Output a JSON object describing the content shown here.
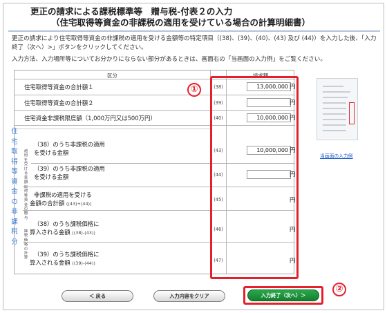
{
  "title": {
    "line1": "更正の請求による課税標準等　贈与税-付表２の入力",
    "line2": "（住宅取得等資金の非課税の適用を受けている場合の計算明細書）"
  },
  "intro": {
    "text": "更正の請求により住宅取得等資金の非課税の適用を受ける金額等の特定項目（(38)、(39)、(40)、(43) 及び (44)）を入力した後、「入力終了（次へ）>」ボタンをクリックしてください。",
    "help": "入力方法、入力場所等についてお分かりにならない部分があるときは、画面右の「当画面の入力例」をご覧ください。"
  },
  "table": {
    "header_category": "区分",
    "header_amount": "請求額",
    "side_label": "住宅取得等資金の非課税分",
    "side_small_top": "適用を受ける金額",
    "side_small_mid": "取得等資金の贈与",
    "side_small_bottom": "課税価格の計算",
    "rows": [
      {
        "label": "住宅取得等資金の合計額１",
        "num": "(38)",
        "value": "13,000,000",
        "yen": "円"
      },
      {
        "label": "住宅取得等資金の合計額２",
        "num": "(39)",
        "value": "",
        "yen": "円"
      },
      {
        "label": "住宅資金非課税限度額（1,000万円又は500万円）",
        "num": "(40)",
        "value": "10,000,000",
        "yen": "円"
      },
      {
        "label": "（38）のうち非課税の適用",
        "label2": "を受ける金額",
        "num": "(43)",
        "value": "10,000,000",
        "yen": "円"
      },
      {
        "label": "（39）のうち非課税の適用",
        "label2": "を受ける金額",
        "num": "(44)",
        "value": "",
        "yen": "円"
      },
      {
        "label": "非課税の適用を受ける",
        "label2": "金額の合計額",
        "note": "((43)+(44))",
        "num": "(45)",
        "value": "",
        "yen": "円"
      },
      {
        "label": "（38）のうち課税価格に",
        "label2": "算入される金額",
        "note": "((38)-(43))",
        "num": "(46)",
        "value": "",
        "yen": "円"
      },
      {
        "label": "（39）のうち課税価格に",
        "label2": "算入される金額",
        "note": "((39)-(44))",
        "num": "(47)",
        "value": "",
        "yen": "円"
      }
    ]
  },
  "annotations": {
    "circle1": "①",
    "circle2": "②"
  },
  "sidebar": {
    "example_link": "当画面の入力例"
  },
  "buttons": {
    "back": "＜ 戻る",
    "clear": "入力内容をクリア",
    "next": "入力終了（次へ）＞"
  },
  "colors": {
    "accent_red": "#e4212b",
    "link_blue": "#1a57c8",
    "next_green": "#1e9440"
  }
}
